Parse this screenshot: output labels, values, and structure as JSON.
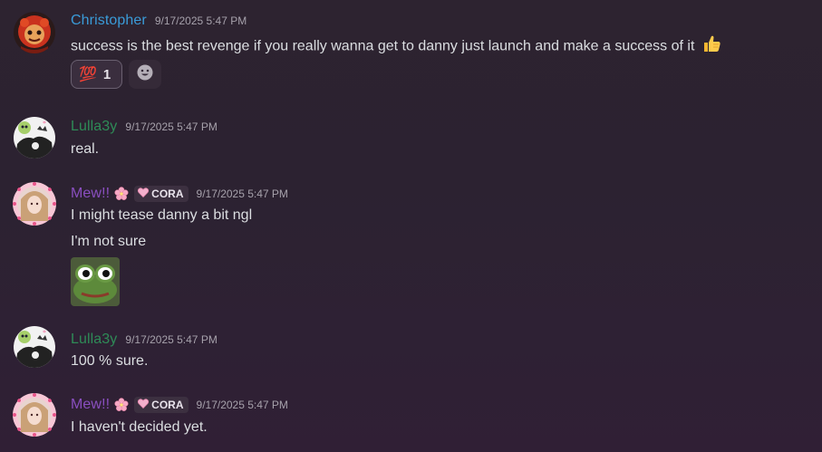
{
  "messages": [
    {
      "username": "Christopher",
      "username_color": "#3a9bd8",
      "timestamp": "9/17/2025 5:47 PM",
      "lines": [
        "success is the best revenge if you really wanna get to danny just launch and make a success of it"
      ],
      "trailing_emoji": "thumbs-up",
      "reaction": {
        "emoji": "💯",
        "count": "1"
      }
    },
    {
      "username": "Lulla3y",
      "username_color": "#2e8b57",
      "timestamp": "9/17/2025 5:47 PM",
      "lines": [
        "real."
      ]
    },
    {
      "username": "Mew!!",
      "username_color": "#8a4fc0",
      "tag": "CORA",
      "timestamp": "9/17/2025 5:47 PM",
      "lines": [
        "I might tease danny a bit ngl",
        "I'm not sure"
      ],
      "sticker": "peepo-frog"
    },
    {
      "username": "Lulla3y",
      "username_color": "#2e8b57",
      "timestamp": "9/17/2025 5:47 PM",
      "lines": [
        "100 % sure."
      ]
    },
    {
      "username": "Mew!!",
      "username_color": "#8a4fc0",
      "tag": "CORA",
      "timestamp": "9/17/2025 5:47 PM",
      "lines": [
        "I haven't decided yet."
      ]
    }
  ]
}
